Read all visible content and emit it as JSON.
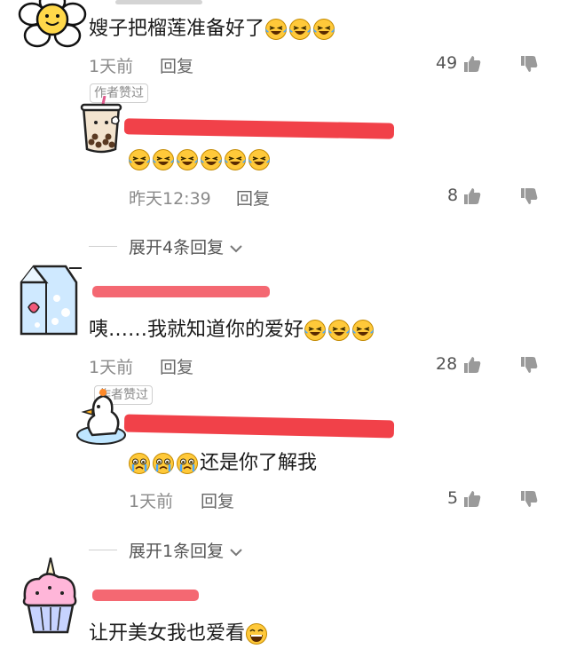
{
  "comments": [
    {
      "text": "嫂子把榴莲准备好了",
      "time": "1天前",
      "reply_label": "回复",
      "likes": "49",
      "laugh_count": 3
    },
    {
      "author_liked": "作者赞过",
      "laugh_count": 6,
      "time": "昨天12:39",
      "reply_label": "回复",
      "likes": "8"
    },
    {
      "text": "咦……我就知道你的爱好",
      "time": "1天前",
      "reply_label": "回复",
      "likes": "28",
      "laugh_count": 3
    },
    {
      "author_liked": "作者赞过",
      "text": "还是你了解我",
      "time": "1天前",
      "reply_label": "回复",
      "likes": "5",
      "cry_count": 3
    },
    {
      "text": "让开美女我也爱看"
    }
  ],
  "expand1": "展开4条回复",
  "expand2": "展开1条回复",
  "colors": {
    "redaction": "#f0313a",
    "emoji_yellow": "#ffc93a",
    "tear_blue": "#4aa8ff"
  },
  "icons": [
    "flower-avatar",
    "milk-tea-avatar",
    "milk-carton-avatar",
    "duck-avatar",
    "cupcake-avatar",
    "thumb-up-icon",
    "thumb-down-icon",
    "laughing-emoji",
    "crying-emoji",
    "chevron-down-icon"
  ]
}
